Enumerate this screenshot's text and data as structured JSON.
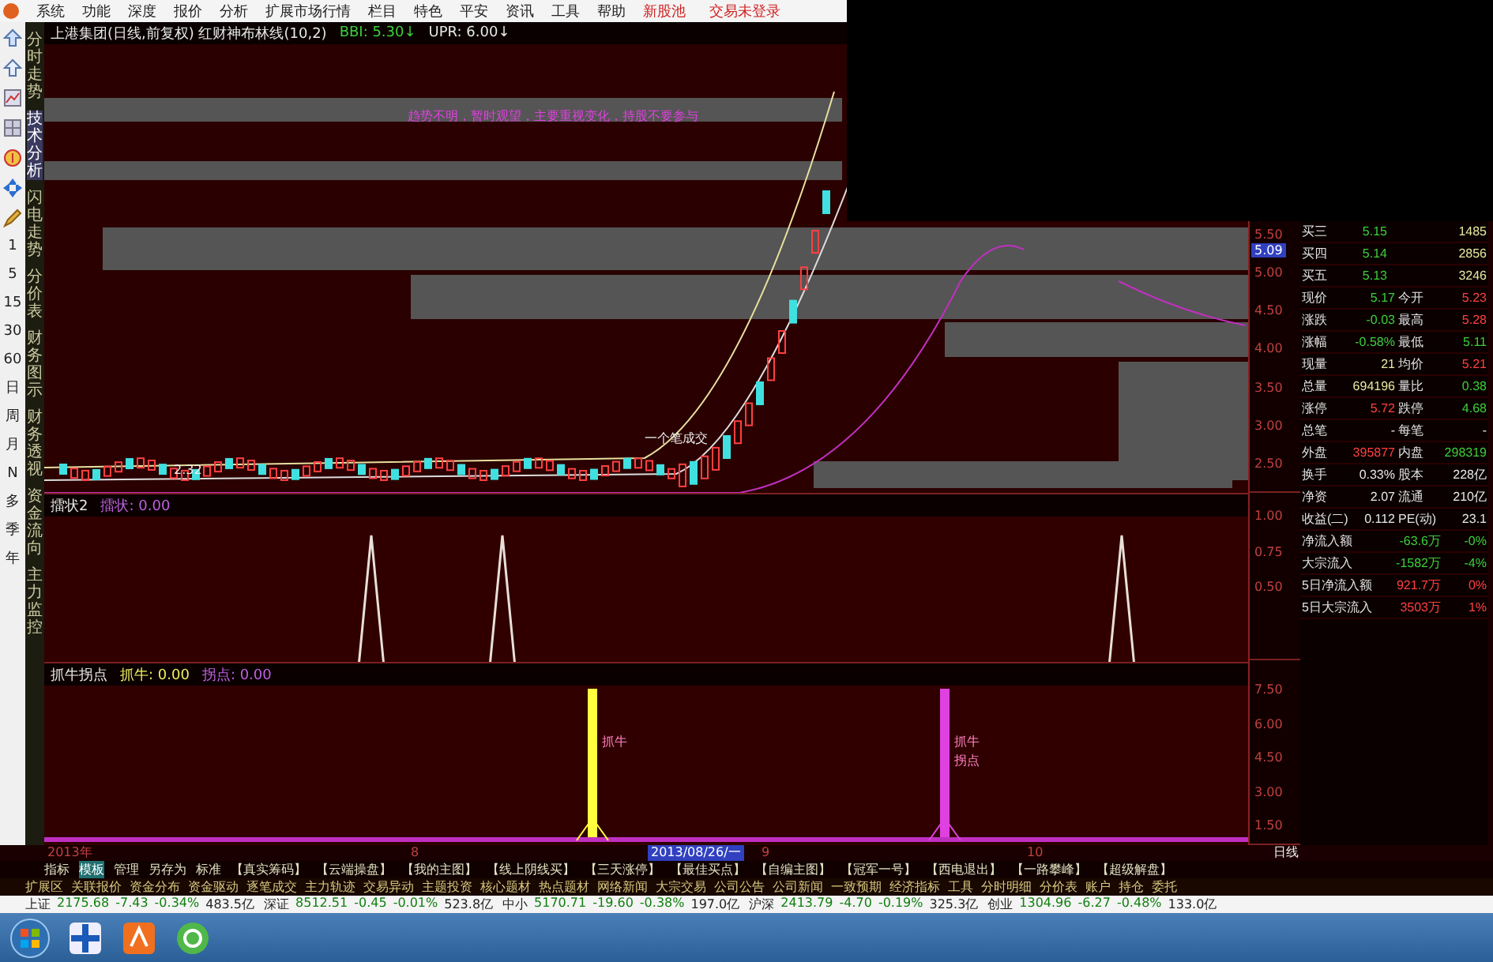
{
  "menu": {
    "items": [
      "系统",
      "功能",
      "深度",
      "报价",
      "分析",
      "扩展市场行情",
      "栏目",
      "特色",
      "平安",
      "资讯",
      "工具",
      "帮助"
    ],
    "highlight": "新股池",
    "login": "交易未登录"
  },
  "periods": [
    "1",
    "5",
    "15",
    "30",
    "60",
    "日",
    "周",
    "月",
    "N",
    "多",
    "季",
    "年"
  ],
  "side_tabs": [
    {
      "label": "分时走势",
      "selected": false
    },
    {
      "label": "技术分析",
      "selected": true
    },
    {
      "label": "闪电走势",
      "selected": false
    },
    {
      "label": "分价表",
      "selected": false
    },
    {
      "label": "财务图示",
      "selected": false
    },
    {
      "label": "财务透视",
      "selected": false
    },
    {
      "label": "资金流向",
      "selected": false
    },
    {
      "label": "主力监控",
      "selected": false
    }
  ],
  "main_panel": {
    "title": "上港集团(日线,前复权) 红财神布林线(10,2)",
    "bbi": "BBI: 5.30↓",
    "upr": "UPR: 6.00↓",
    "signal": "趋势不明，暂时观望，主要重视变化，持股不要参与",
    "trade_label": "一个笔成交",
    "low_label": "2.32",
    "price_tag": "5.09",
    "ticks": [
      "5.50",
      "5.00",
      "4.50",
      "4.00",
      "3.50",
      "3.00",
      "2.50"
    ]
  },
  "panel_2": {
    "name": "擂状2",
    "reading": "擂状: 0.00",
    "ticks": [
      "1.00",
      "0.75",
      "0.50"
    ]
  },
  "panel_3": {
    "name": "抓牛拐点",
    "reading_1": "抓牛: 0.00",
    "reading_2": "拐点: 0.00",
    "markers": [
      {
        "kind": "bull",
        "label": "抓牛"
      },
      {
        "kind": "turn",
        "label": "抓牛",
        "label_2": "拐点"
      }
    ],
    "ticks": [
      "7.50",
      "6.00",
      "4.50",
      "3.00",
      "1.50"
    ]
  },
  "quote": [
    {
      "kind": "single",
      "left": {
        "label": "买三",
        "value": "5.15",
        "color": "#3ccf3c"
      },
      "right": {
        "value": "1485",
        "color": "#e8e8a0"
      }
    },
    {
      "kind": "single",
      "left": {
        "label": "买四",
        "value": "5.14",
        "color": "#3ccf3c"
      },
      "right": {
        "value": "2856",
        "color": "#e8e8a0"
      }
    },
    {
      "kind": "single",
      "left": {
        "label": "买五",
        "value": "5.13",
        "color": "#3ccf3c"
      },
      "right": {
        "value": "3246",
        "color": "#e8e8a0"
      }
    },
    {
      "kind": "pair",
      "left": {
        "label": "现价",
        "value": "5.17",
        "color": "#3ccf3c"
      },
      "right": {
        "label": "今开",
        "value": "5.23",
        "color": "#ff4040"
      }
    },
    {
      "kind": "pair",
      "left": {
        "label": "涨跌",
        "value": "-0.03",
        "color": "#3ccf3c"
      },
      "right": {
        "label": "最高",
        "value": "5.28",
        "color": "#ff4040"
      }
    },
    {
      "kind": "pair",
      "left": {
        "label": "涨幅",
        "value": "-0.58%",
        "color": "#3ccf3c"
      },
      "right": {
        "label": "最低",
        "value": "5.11",
        "color": "#3ccf3c"
      }
    },
    {
      "kind": "pair",
      "left": {
        "label": "现量",
        "value": "21",
        "color": "#e8e8a0"
      },
      "right": {
        "label": "均价",
        "value": "5.21",
        "color": "#ff4040"
      }
    },
    {
      "kind": "pair",
      "left": {
        "label": "总量",
        "value": "694196",
        "color": "#e8e8a0"
      },
      "right": {
        "label": "量比",
        "value": "0.38",
        "color": "#3ccf3c"
      }
    },
    {
      "kind": "pair",
      "left": {
        "label": "涨停",
        "value": "5.72",
        "color": "#ff4040"
      },
      "right": {
        "label": "跌停",
        "value": "4.68",
        "color": "#3ccf3c"
      }
    },
    {
      "kind": "pair",
      "left": {
        "label": "总笔",
        "value": "-"
      },
      "right": {
        "label": "每笔",
        "value": "-"
      }
    },
    {
      "kind": "pair",
      "left": {
        "label": "外盘",
        "value": "395877",
        "color": "#ff4040"
      },
      "right": {
        "label": "内盘",
        "value": "298319",
        "color": "#3ccf3c"
      }
    },
    {
      "kind": "pair",
      "left": {
        "label": "换手",
        "value": "0.33%",
        "color": "#e8e8e8"
      },
      "right": {
        "label": "股本",
        "value": "228亿",
        "color": "#e8e8e8"
      }
    },
    {
      "kind": "pair",
      "left": {
        "label": "净资",
        "value": "2.07",
        "color": "#e8e8e8"
      },
      "right": {
        "label": "流通",
        "value": "210亿",
        "color": "#e8e8e8"
      }
    },
    {
      "kind": "pair",
      "left": {
        "label": "收益(二)",
        "value": "0.112",
        "color": "#e8e8e8"
      },
      "right": {
        "label": "PE(动)",
        "value": "23.1",
        "color": "#e8e8e8"
      }
    },
    {
      "kind": "flow",
      "left": {
        "label": "净流入额",
        "value": "-63.6万",
        "color": "#3ccf3c"
      },
      "right": {
        "value": "-0%",
        "color": "#3ccf3c"
      }
    },
    {
      "kind": "flow",
      "left": {
        "label": "大宗流入",
        "value": "-1582万",
        "color": "#3ccf3c"
      },
      "right": {
        "value": "-4%",
        "color": "#3ccf3c"
      }
    },
    {
      "kind": "flow",
      "left": {
        "label": "5日净流入额",
        "value": "921.7万",
        "color": "#ff4040"
      },
      "right": {
        "value": "0%",
        "color": "#ff4040"
      }
    },
    {
      "kind": "flow",
      "left": {
        "label": "5日大宗流入",
        "value": "3503万",
        "color": "#ff4040"
      },
      "right": {
        "value": "1%",
        "color": "#ff4040"
      }
    }
  ],
  "time_axis": {
    "year": "2013年",
    "m1": "8",
    "cursor": "2013/08/26/一",
    "m2": "9",
    "m3": "10",
    "period": "日线"
  },
  "formula_tabs": [
    {
      "label": "指标",
      "selected": false
    },
    {
      "label": "模板",
      "selected": true
    },
    {
      "label": "管理",
      "selected": false
    },
    {
      "label": "另存为",
      "selected": false
    },
    {
      "label": "标准",
      "selected": false
    },
    {
      "label": "【真实筹码】",
      "selected": false
    },
    {
      "label": "【云端操盘】",
      "selected": false
    },
    {
      "label": "【我的主图】",
      "selected": false
    },
    {
      "label": "【线上阴线买】",
      "selected": false
    },
    {
      "label": "【三天涨停】",
      "selected": false
    },
    {
      "label": "【最佳买点】",
      "selected": false
    },
    {
      "label": "【自编主图】",
      "selected": false
    },
    {
      "label": "【冠军一号】",
      "selected": false
    },
    {
      "label": "【西电退出】",
      "selected": false
    },
    {
      "label": "【一路攀峰】",
      "selected": false
    },
    {
      "label": "【超级解盘】",
      "selected": false
    }
  ],
  "links": [
    "扩展区",
    "关联报价",
    "资金分布",
    "资金驱动",
    "逐笔成交",
    "主力轨迹",
    "交易异动",
    "主题投资",
    "核心题材",
    "热点题材",
    "网络新闻",
    "大宗交易",
    "公司公告",
    "公司新闻",
    "一致预期",
    "经济指标",
    "工具",
    "分时明细",
    "分价表",
    "账户",
    "持仓",
    "委托"
  ],
  "ticker": [
    {
      "name": "上证",
      "value": "2175.68",
      "change": "-7.43",
      "pct": "-0.34%",
      "amount": "483.5亿"
    },
    {
      "name": "深证",
      "value": "8512.51",
      "change": "-0.45",
      "pct": "-0.01%",
      "amount": "523.8亿"
    },
    {
      "name": "中小",
      "value": "5170.71",
      "change": "-19.60",
      "pct": "-0.38%",
      "amount": "197.0亿"
    },
    {
      "name": "沪深",
      "value": "2413.79",
      "change": "-4.70",
      "pct": "-0.19%",
      "amount": "325.3亿"
    },
    {
      "name": "创业",
      "value": "1304.96",
      "change": "-6.27",
      "pct": "-0.48%",
      "amount": "133.0亿"
    }
  ]
}
